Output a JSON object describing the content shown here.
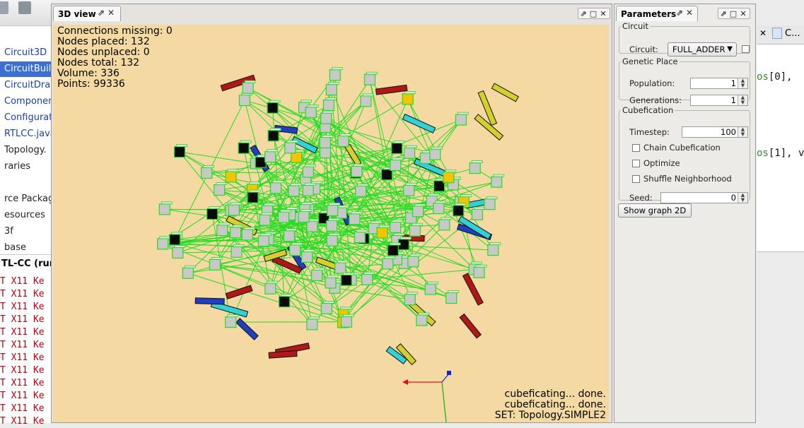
{
  "left_panel": {
    "tree_items": [
      {
        "label": "Circuit3D",
        "style": "link"
      },
      {
        "label": "CircuitBuil",
        "style": "selected"
      },
      {
        "label": "CircuitDra",
        "style": "link"
      },
      {
        "label": "Componen",
        "style": "link"
      },
      {
        "label": "Configurat",
        "style": "link"
      },
      {
        "label": "RTLCC.java",
        "style": "link"
      },
      {
        "label": "Topology.",
        "style": "plain"
      },
      {
        "label": "raries",
        "style": "plain"
      },
      {
        "label": "",
        "style": "plain"
      },
      {
        "label": "rce Packag",
        "style": "plain"
      },
      {
        "label": "esources",
        "style": "plain"
      },
      {
        "label": "3f",
        "style": "plain"
      },
      {
        "label": "base",
        "style": "plain"
      }
    ],
    "output_header": "TL-CC (run",
    "output_lines": [
      "T X11 Ke",
      "T X11 Ke",
      "T X11 Ke",
      "T X11 Ke",
      "T X11 Ke",
      "T X11 Ke",
      "T X11 Ke",
      "T X11 Ke",
      "T X11 Ke",
      "T X11 Ke",
      "T X11 Ke",
      "T X11 Ke"
    ]
  },
  "view3d": {
    "tab_label": "3D view",
    "pin_icon": "pin-icon",
    "hud": [
      "Connections missing: 0",
      "Nodes placed: 132",
      "Nodes unplaced: 0",
      "Nodes total: 132",
      "Volume: 336",
      "Points: 99336"
    ],
    "status": [
      "cubeficating... done.",
      "cubeficating... done.",
      "SET: Topology.SIMPLE2"
    ],
    "colors": {
      "background": "#f4d9a2",
      "edge": "#22dd22",
      "node": "#c8c8c8",
      "node_black": "#0a0a0a",
      "node_yellow": "#f5c400"
    }
  },
  "params": {
    "tab_label": "Parameters",
    "circuit": {
      "legend": "Circuit",
      "label": "Circuit:",
      "value": "FULL_ADDER"
    },
    "genetic": {
      "legend": "Genetic Place",
      "population_label": "Population:",
      "population": "1",
      "generations_label": "Generations:",
      "generations": "1"
    },
    "cubefication": {
      "legend": "Cubefication",
      "timestep_label": "Timestep:",
      "timestep": "100",
      "chain": "Chain Cubefication",
      "optimize": "Optimize",
      "shuffle": "Shuffle Neighborhood",
      "seed_label": "Seed:",
      "seed": "0"
    },
    "show_graph_button": "Show graph 2D"
  },
  "right_panel": {
    "tab_label": "C...",
    "code_lines": [
      {
        "prefix": "os",
        "suffix": "[0],"
      },
      {
        "prefix": "os",
        "suffix": "[1], v"
      }
    ]
  }
}
